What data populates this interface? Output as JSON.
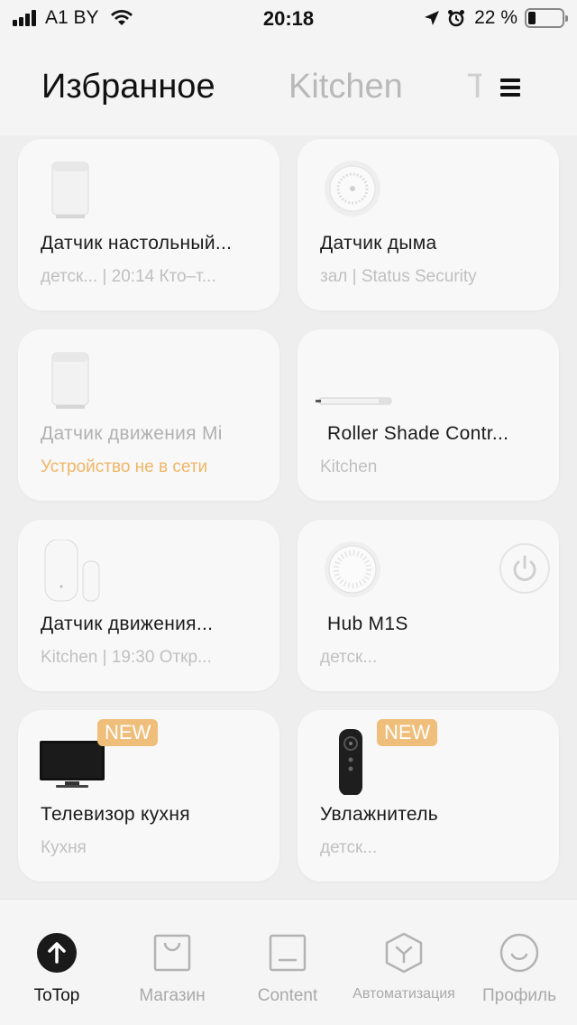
{
  "status_bar": {
    "carrier": "A1 BY",
    "time": "20:18",
    "battery_percent": "22 %",
    "battery_level": 0.22,
    "icons": [
      "signal-bars-icon",
      "wifi-icon",
      "location-arrow-icon",
      "alarm-clock-icon",
      "battery-icon"
    ]
  },
  "header": {
    "tabs": [
      {
        "label": "Избранное",
        "active": true
      },
      {
        "label": "Kitchen",
        "active": false
      },
      {
        "label": "Т",
        "active": false
      }
    ],
    "menu_icon": "hamburger-menu-icon"
  },
  "devices": [
    {
      "name": "Датчик настольный...",
      "subtitle": "детск... | 20:14 Кто–т...",
      "icon": "motion-sensor-icon"
    },
    {
      "name": "Датчик дыма",
      "subtitle": "зал | Status Security",
      "icon": "smoke-detector-icon"
    },
    {
      "name": "Датчик движения Mi",
      "subtitle": "Устройство не в сети",
      "icon": "motion-sensor-icon",
      "offline": true
    },
    {
      "name": "Roller Shade Contr...",
      "subtitle": "Kitchen",
      "icon": "roller-shade-icon"
    },
    {
      "name": "Датчик движения...",
      "subtitle": "Kitchen | 19:30 Откр...",
      "icon": "door-window-sensor-icon"
    },
    {
      "name": "Hub M1S",
      "subtitle": "детск...",
      "icon": "hub-icon",
      "power_button": "power-icon"
    },
    {
      "name": "Телевизор кухня",
      "subtitle": "Кухня",
      "icon": "tv-icon",
      "badge": "NEW"
    },
    {
      "name": "Увлажнитель",
      "subtitle": "детск...",
      "icon": "remote-control-icon",
      "badge": "NEW"
    }
  ],
  "bottom_nav": [
    {
      "label": "ToTop",
      "icon": "arrow-up-circle-icon",
      "active": true
    },
    {
      "label": "Магазин",
      "icon": "shopping-bag-icon"
    },
    {
      "label": "Content",
      "icon": "content-square-icon"
    },
    {
      "label": "Автоматизация",
      "icon": "automation-cube-icon"
    },
    {
      "label": "Профиль",
      "icon": "profile-smile-icon"
    }
  ],
  "colors": {
    "badge": "#efbe7a",
    "offline_text": "#f0b565",
    "inactive_tab": "#b9b9b9"
  }
}
